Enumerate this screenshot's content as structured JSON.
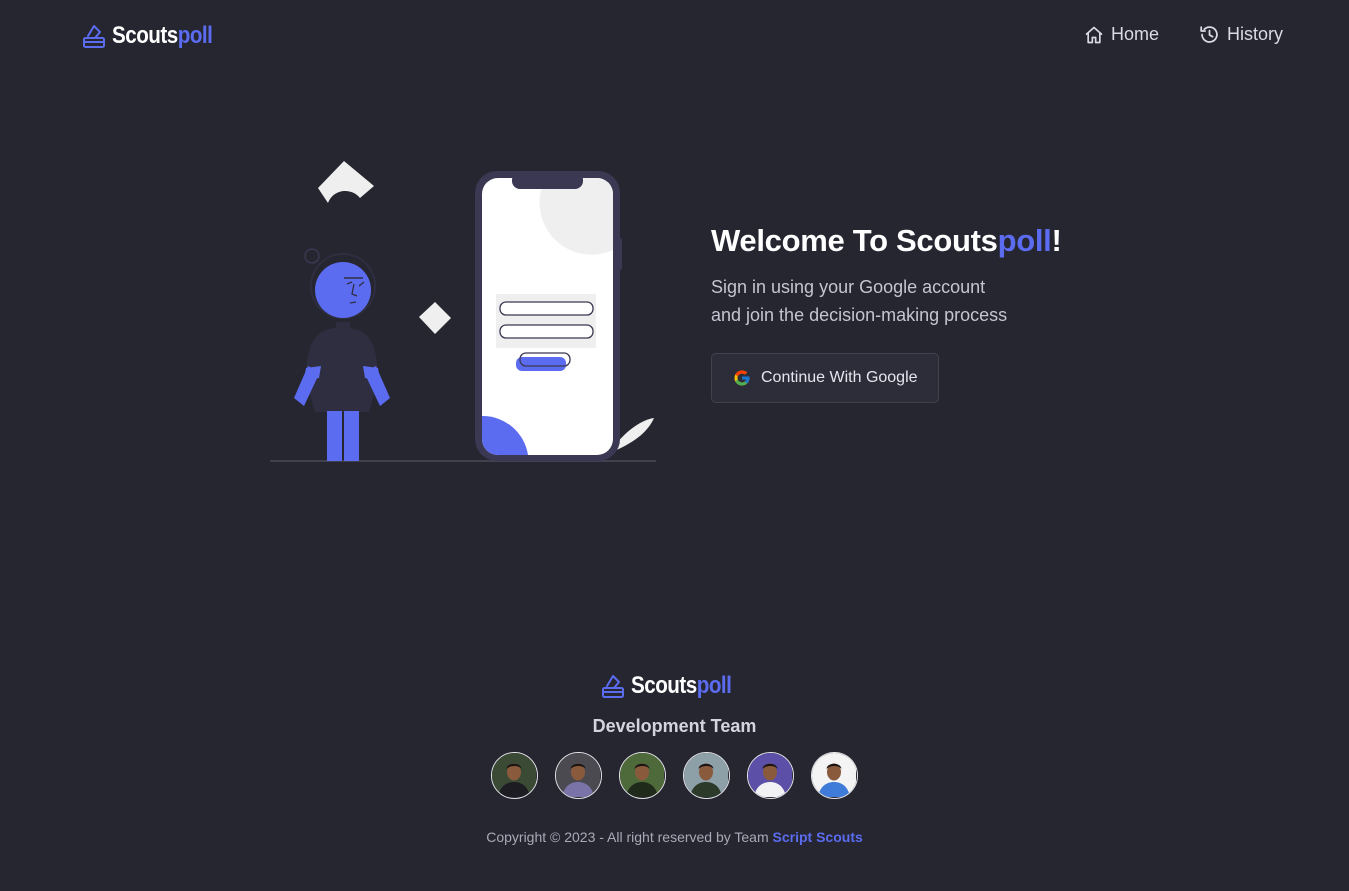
{
  "header": {
    "logo": {
      "part1": "Scouts",
      "part2": "poll",
      "icon": "ballot-box-icon"
    },
    "nav": [
      {
        "label": "Home",
        "icon": "home-icon"
      },
      {
        "label": "History",
        "icon": "history-icon"
      }
    ]
  },
  "hero": {
    "title_prefix": "Welcome To Scouts",
    "title_accent": "poll",
    "title_suffix": "!",
    "subtitle_line1": "Sign in using your Google account",
    "subtitle_line2": "and join the decision-making process",
    "google_button_label": "Continue With Google",
    "google_icon": "google-icon"
  },
  "footer": {
    "logo": {
      "part1": "Scouts",
      "part2": "poll"
    },
    "team_title": "Development Team",
    "avatars": [
      {
        "bg": "#3a4a35",
        "shirt": "#1c1c22"
      },
      {
        "bg": "#4a4a50",
        "shirt": "#7a73a8"
      },
      {
        "bg": "#4f6a3a",
        "shirt": "#1f2a1a"
      },
      {
        "bg": "#8da0a8",
        "shirt": "#2c3a2a"
      },
      {
        "bg": "#5b4fa8",
        "shirt": "#f2f2f5"
      },
      {
        "bg": "#f4f4f4",
        "shirt": "#3f7bd9"
      }
    ],
    "copyright_prefix": "Copyright © 2023 - All right reserved by Team ",
    "copyright_link": "Script Scouts"
  },
  "colors": {
    "background": "#262631",
    "accent": "#5b6cf0",
    "text": "#ffffff"
  }
}
